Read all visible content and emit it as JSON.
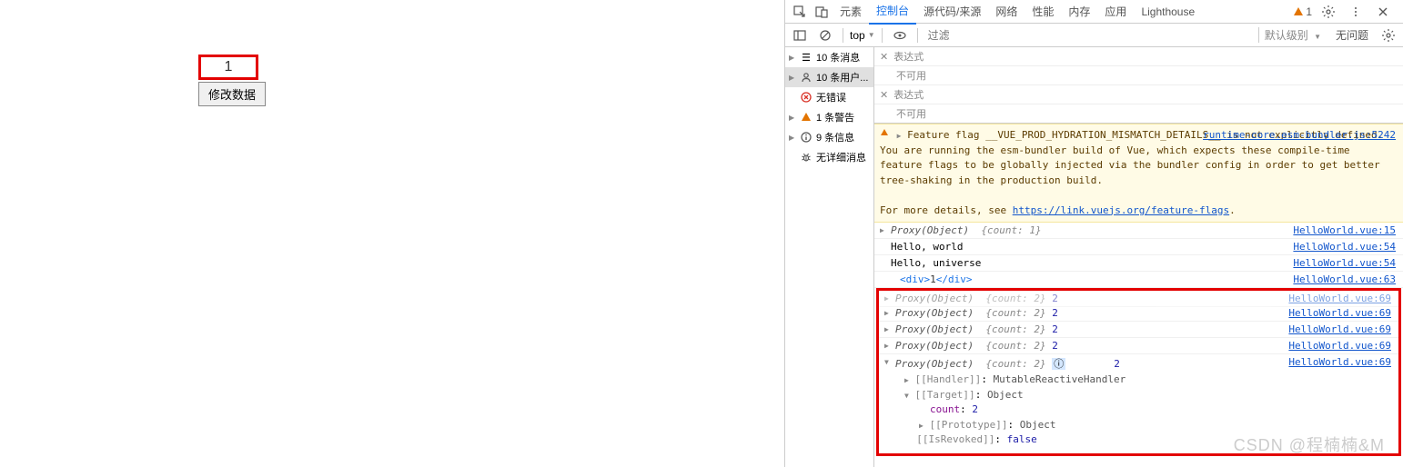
{
  "app": {
    "counter_value": "1",
    "button_label": "修改数据"
  },
  "tabs": {
    "elements": "元素",
    "console": "控制台",
    "sources": "源代码/来源",
    "network": "网络",
    "performance": "性能",
    "memory": "内存",
    "application": "应用",
    "lighthouse": "Lighthouse",
    "warn_count": "1"
  },
  "toolbar": {
    "context": "top",
    "filter_placeholder": "过滤",
    "level": "默认级别",
    "issues": "无问题"
  },
  "sidebar": {
    "messages": "10 条消息",
    "user": "10 条用户...",
    "errors": "无错误",
    "warnings": "1 条警告",
    "info": "9 条信息",
    "verbose": "无详细消息"
  },
  "watch": {
    "expr": "表达式",
    "unavailable": "不可用"
  },
  "warning": {
    "text1": "Feature flag __VUE_PROD_HYDRATION_MISMATCH_DETAILS__ is not explicitly defined. You are running the esm-bundler build of Vue, which expects these compile-time feature flags to be globally injected via the bundler config in order to get better tree-shaking in the production build.",
    "text2": "For more details, see ",
    "link": "https://link.vuejs.org/feature-flags",
    "source": "runtime-core.esm-bundler.js:5242"
  },
  "logs": [
    {
      "type": "proxy",
      "preview": "{count: 1}",
      "extra": "",
      "source": "HelloWorld.vue:15"
    },
    {
      "type": "text",
      "text": "Hello, world",
      "source": "HelloWorld.vue:54"
    },
    {
      "type": "text",
      "text": "Hello, universe",
      "source": "HelloWorld.vue:54"
    },
    {
      "type": "html",
      "tag_open": "<div>",
      "text": "1",
      "tag_close": "</div>",
      "source": "HelloWorld.vue:63"
    },
    {
      "type": "proxy",
      "preview": "{count: 2}",
      "extra": "2",
      "source": "HelloWorld.vue:69"
    },
    {
      "type": "proxy",
      "preview": "{count: 2}",
      "extra": "2",
      "source": "HelloWorld.vue:69"
    },
    {
      "type": "proxy",
      "preview": "{count: 2}",
      "extra": "2",
      "source": "HelloWorld.vue:69"
    },
    {
      "type": "proxy",
      "preview": "{count: 2}",
      "extra": "2",
      "source": "HelloWorld.vue:69"
    }
  ],
  "expanded": {
    "header_name": "Proxy(Object)",
    "header_preview": "{count: 2}",
    "header_extra": "2",
    "header_source": "HelloWorld.vue:69",
    "handler_label": "[[Handler]]",
    "handler_val": "MutableReactiveHandler",
    "target_label": "[[Target]]",
    "target_val": "Object",
    "count_key": "count",
    "count_val": "2",
    "proto_label": "[[Prototype]]",
    "proto_val": "Object",
    "revoked_label": "[[IsRevoked]]",
    "revoked_val": "false"
  },
  "watermark": "CSDN @程楠楠&M"
}
